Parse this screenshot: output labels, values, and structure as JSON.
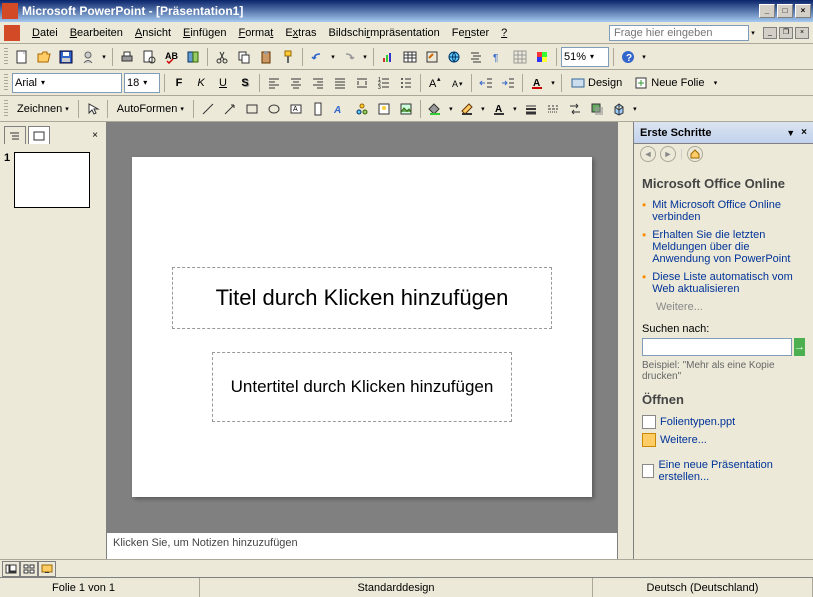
{
  "titlebar": {
    "text": "Microsoft PowerPoint - [Präsentation1]"
  },
  "menubar": {
    "items": [
      {
        "label": "Datei",
        "u": "D"
      },
      {
        "label": "Bearbeiten",
        "u": "B"
      },
      {
        "label": "Ansicht",
        "u": "A"
      },
      {
        "label": "Einfügen",
        "u": "E"
      },
      {
        "label": "Format",
        "u": "F"
      },
      {
        "label": "Extras",
        "u": "x"
      },
      {
        "label": "Bildschirmpräsentation",
        "u": "r"
      },
      {
        "label": "Fenster",
        "u": "n"
      },
      {
        "label": "?",
        "u": "?"
      }
    ],
    "help_placeholder": "Frage hier eingeben"
  },
  "toolbar1": {
    "zoom": "51%"
  },
  "toolbar2": {
    "font": "Arial",
    "size": "18",
    "design_label": "Design",
    "new_slide_label": "Neue Folie"
  },
  "toolbar3": {
    "draw_label": "Zeichnen",
    "autoshapes_label": "AutoFormen"
  },
  "left": {
    "slide_number": "1"
  },
  "slide": {
    "title_placeholder": "Titel durch Klicken hinzufügen",
    "subtitle_placeholder": "Untertitel durch Klicken hinzufügen"
  },
  "notes": {
    "placeholder": "Klicken Sie, um Notizen hinzuzufügen"
  },
  "taskpane": {
    "title": "Erste Schritte",
    "section1_title": "Microsoft Office Online",
    "links": [
      "Mit Microsoft Office Online verbinden",
      "Erhalten Sie die letzten Meldungen über die Anwendung von PowerPoint",
      "Diese Liste automatisch vom Web aktualisieren"
    ],
    "more": "Weitere...",
    "search_label": "Suchen nach:",
    "search_example": "Beispiel: \"Mehr als eine Kopie drucken\"",
    "section2_title": "Öffnen",
    "open_file": "Folientypen.ppt",
    "open_more": "Weitere...",
    "new_presentation": "Eine neue Präsentation erstellen..."
  },
  "statusbar": {
    "slide_info": "Folie 1 von 1",
    "design": "Standarddesign",
    "language": "Deutsch (Deutschland)"
  }
}
